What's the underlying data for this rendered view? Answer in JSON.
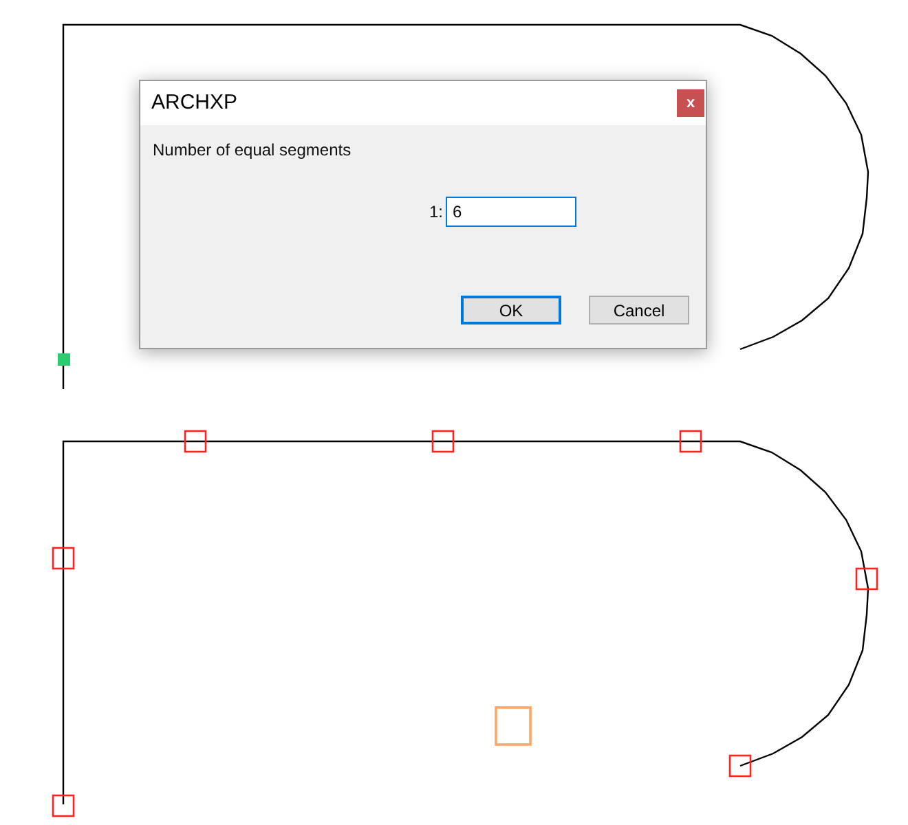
{
  "dialog": {
    "title": "ARCHXP",
    "close_label": "x",
    "prompt": "Number of equal segments",
    "field": {
      "label": "1:",
      "value": "6",
      "focused": true
    },
    "buttons": [
      {
        "label": "OK",
        "default": true
      },
      {
        "label": "Cancel",
        "default": false
      }
    ]
  }
}
